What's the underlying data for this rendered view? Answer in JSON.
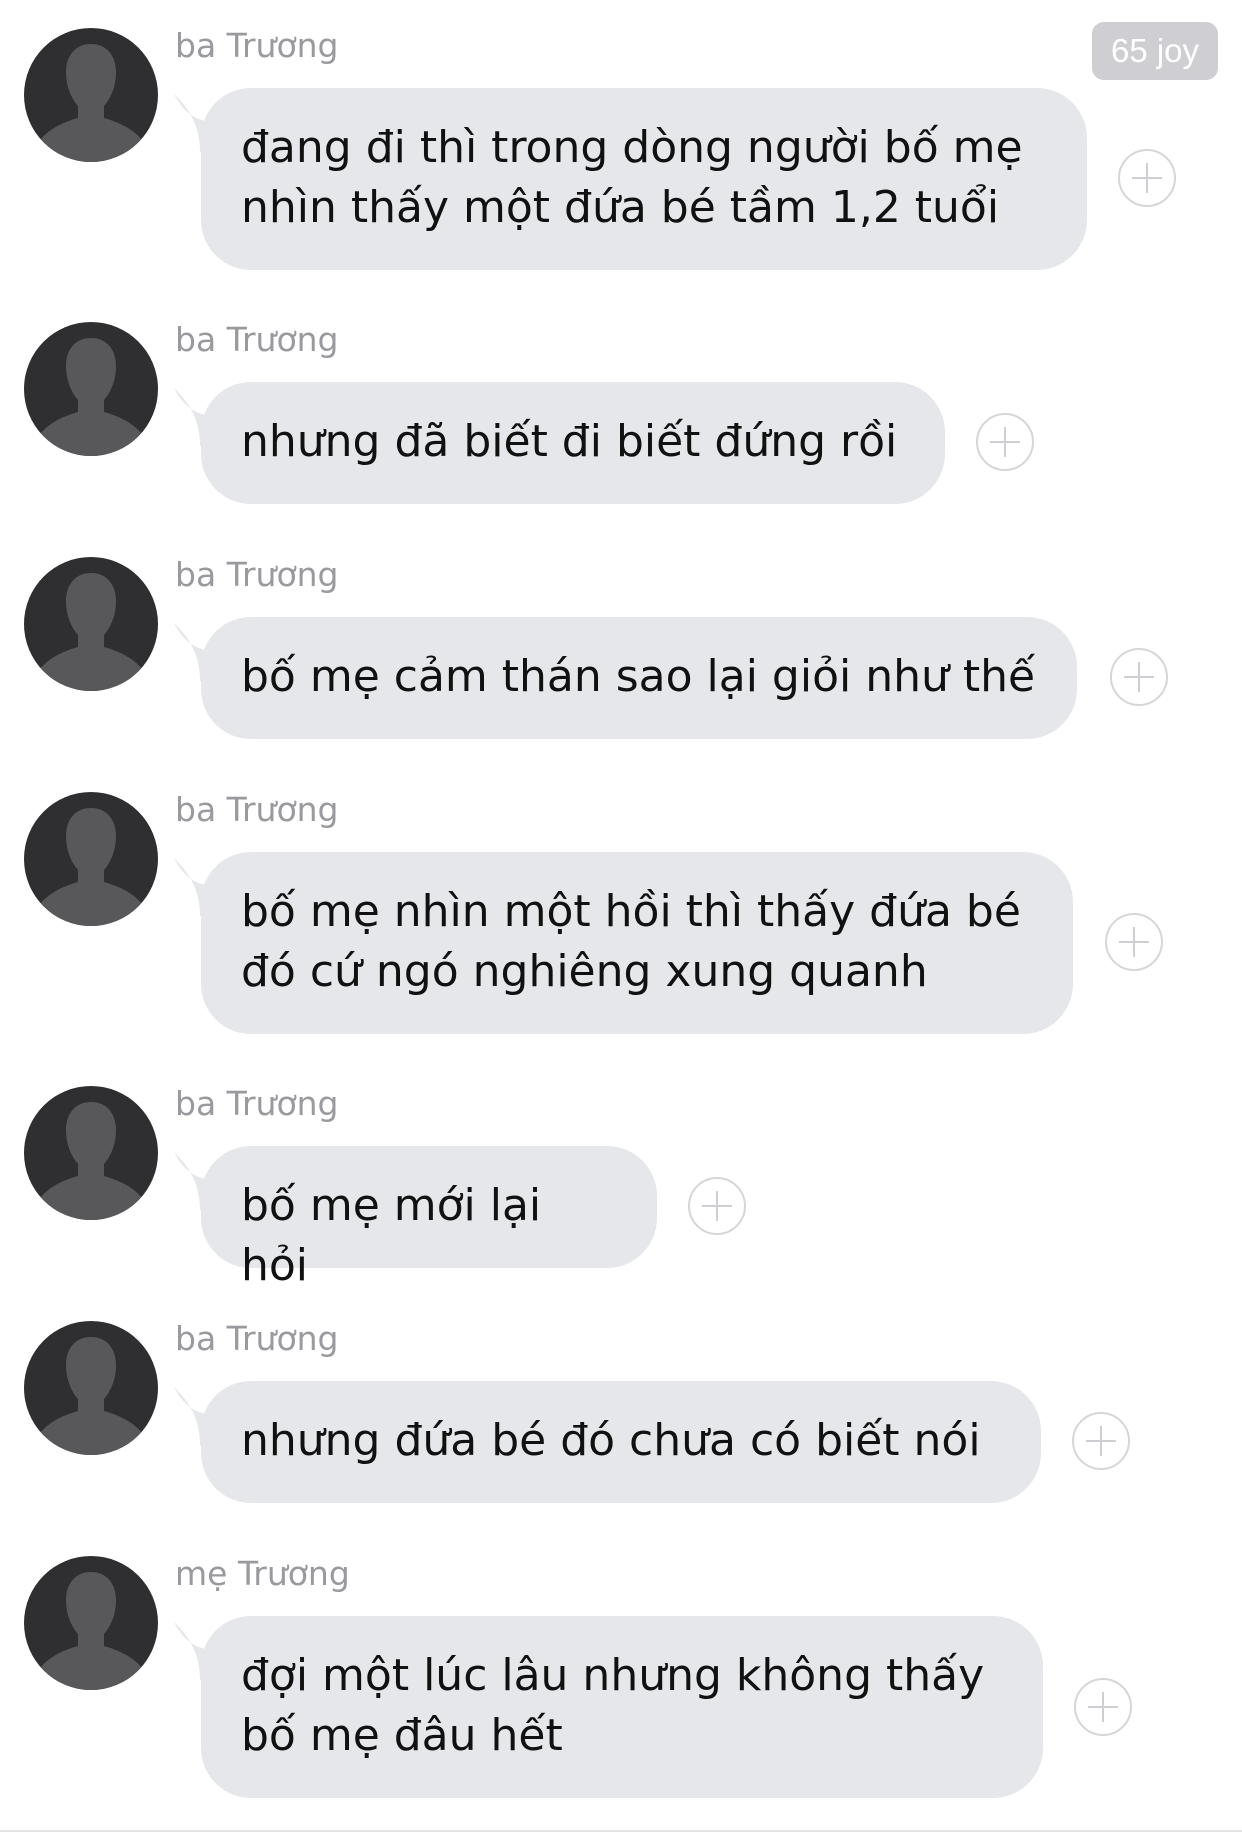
{
  "header": {
    "badge_label": "65 joy"
  },
  "colors": {
    "bubble_background": "#e5e7ea",
    "avatar_background": "#2f2f31",
    "sender_text": "#9a9a9e",
    "badge_background": "#cfcfd3"
  },
  "messages": [
    {
      "sender": "ba Trương",
      "text": "đang đi thì trong dòng người bố mẹ\nnhìn thấy một đứa bé tầm 1,2 tuổi",
      "icon": "person-silhouette-icon"
    },
    {
      "sender": "ba Trương",
      "text": "nhưng đã biết đi biết đứng rồi",
      "icon": "person-silhouette-icon"
    },
    {
      "sender": "ba Trương",
      "text": "bố mẹ cảm thán sao lại giỏi như thế",
      "icon": "person-silhouette-icon"
    },
    {
      "sender": "ba Trương",
      "text": "bố mẹ nhìn một hồi thì thấy đứa bé\nđó cứ ngó nghiêng xung quanh",
      "icon": "person-silhouette-icon"
    },
    {
      "sender": "ba Trương",
      "text": "bố mẹ mới lại hỏi",
      "icon": "person-silhouette-icon"
    },
    {
      "sender": "ba Trương",
      "text": "nhưng đứa bé đó chưa có biết nói",
      "icon": "person-silhouette-icon"
    },
    {
      "sender": "mẹ Trương",
      "text": "đợi một lúc lâu nhưng không thấy\nbố mẹ đâu hết",
      "icon": "person-silhouette-icon"
    }
  ]
}
